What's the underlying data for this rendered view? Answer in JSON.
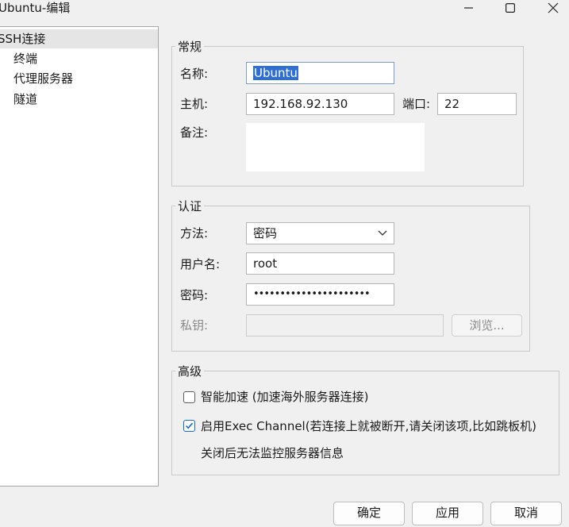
{
  "window": {
    "title": "Ubuntu-编辑",
    "minimize_glyph": "—",
    "maximize_glyph": "☐",
    "close_glyph": "✕"
  },
  "nav": {
    "items": [
      {
        "label": "SSH连接"
      },
      {
        "label": "终端"
      },
      {
        "label": "代理服务器"
      },
      {
        "label": "隧道"
      }
    ]
  },
  "general": {
    "legend": "常规",
    "name_label": "名称:",
    "name_value": "Ubuntu",
    "host_label": "主机:",
    "host_value": "192.168.92.130",
    "port_label": "端口:",
    "port_value": "22",
    "note_label": "备注:",
    "note_value": ""
  },
  "auth": {
    "legend": "认证",
    "method_label": "方法:",
    "method_value": "密码",
    "username_label": "用户名:",
    "username_value": "root",
    "password_label": "密码:",
    "password_value": "••••••••••••••••••••••",
    "key_label": "私钥:",
    "key_value": "",
    "browse_label": "浏览..."
  },
  "advanced": {
    "legend": "高级",
    "smart_accel_label": "智能加速 (加速海外服务器连接)",
    "smart_accel_checked": false,
    "exec_channel_label": "启用Exec Channel(若连接上就被断开,请关闭该项,比如跳板机)",
    "exec_channel_checked": true,
    "exec_channel_note": "关闭后无法监控服务器信息"
  },
  "footer": {
    "ok_label": "确定",
    "apply_label": "应用",
    "cancel_label": "取消"
  },
  "colors": {
    "accent": "#1b69c6",
    "selection": "#2f6fd1",
    "disabled_text": "#8a8a8a"
  }
}
